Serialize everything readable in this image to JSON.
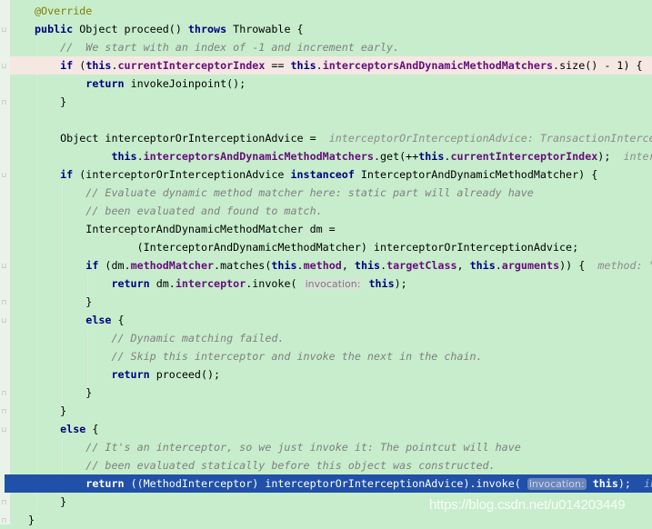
{
  "editor": {
    "background": "#c7edcc",
    "highlight_line": 4,
    "selected_line": 27,
    "watermark": "https://blog.csdn.net/u014203449"
  },
  "code": {
    "lines": [
      {
        "tokens": [
          [
            "a",
            "@Override"
          ]
        ]
      },
      {
        "tokens": [
          [
            "k",
            "public "
          ],
          [
            "p",
            "Object proceed() "
          ],
          [
            "k",
            "throws "
          ],
          [
            "p",
            "Throwable {"
          ]
        ]
      },
      {
        "tokens": [
          [
            "c",
            "    //  We start with an index of -1 and increment early."
          ]
        ]
      },
      {
        "tokens": [
          [
            "k",
            "    if "
          ],
          [
            "p",
            "("
          ],
          [
            "k",
            "this"
          ],
          [
            "p",
            "."
          ],
          [
            "f",
            "currentInterceptorIndex"
          ],
          [
            "p",
            " == "
          ],
          [
            "k",
            "this"
          ],
          [
            "p",
            "."
          ],
          [
            "f",
            "interceptorsAndDynamicMethodMatchers"
          ],
          [
            "p",
            ".size() - 1) {"
          ]
        ]
      },
      {
        "tokens": [
          [
            "k",
            "        return "
          ],
          [
            "p",
            "invokeJoinpoint();"
          ]
        ]
      },
      {
        "tokens": [
          [
            "p",
            "    }"
          ]
        ]
      },
      {
        "tokens": [
          [
            "p",
            ""
          ]
        ]
      },
      {
        "tokens": [
          [
            "p",
            "    Object interceptorOrInterceptionAdvice =  "
          ],
          [
            "h",
            "interceptorOrInterceptionAdvice: TransactionIntercep"
          ]
        ]
      },
      {
        "tokens": [
          [
            "k",
            "            this"
          ],
          [
            "p",
            "."
          ],
          [
            "f",
            "interceptorsAndDynamicMethodMatchers"
          ],
          [
            "p",
            ".get(++"
          ],
          [
            "k",
            "this"
          ],
          [
            "p",
            "."
          ],
          [
            "f",
            "currentInterceptorIndex"
          ],
          [
            "p",
            ");  "
          ],
          [
            "h",
            "inter"
          ]
        ]
      },
      {
        "tokens": [
          [
            "k",
            "    if "
          ],
          [
            "p",
            "(interceptorOrInterceptionAdvice "
          ],
          [
            "k",
            "instanceof "
          ],
          [
            "p",
            "InterceptorAndDynamicMethodMatcher) {"
          ]
        ]
      },
      {
        "tokens": [
          [
            "c",
            "        // Evaluate dynamic method matcher here: static part will already have"
          ]
        ]
      },
      {
        "tokens": [
          [
            "c",
            "        // been evaluated and found to match."
          ]
        ]
      },
      {
        "tokens": [
          [
            "p",
            "        InterceptorAndDynamicMethodMatcher dm ="
          ]
        ]
      },
      {
        "tokens": [
          [
            "p",
            "                (InterceptorAndDynamicMethodMatcher) interceptorOrInterceptionAdvice;"
          ]
        ]
      },
      {
        "tokens": [
          [
            "k",
            "        if "
          ],
          [
            "p",
            "(dm."
          ],
          [
            "f",
            "methodMatcher"
          ],
          [
            "p",
            ".matches("
          ],
          [
            "k",
            "this"
          ],
          [
            "p",
            "."
          ],
          [
            "f",
            "method"
          ],
          [
            "p",
            ", "
          ],
          [
            "k",
            "this"
          ],
          [
            "p",
            "."
          ],
          [
            "f",
            "targetClass"
          ],
          [
            "p",
            ", "
          ],
          [
            "k",
            "this"
          ],
          [
            "p",
            "."
          ],
          [
            "f",
            "arguments"
          ],
          [
            "p",
            ")) {  "
          ],
          [
            "h",
            "method: \""
          ]
        ]
      },
      {
        "tokens": [
          [
            "k",
            "            return "
          ],
          [
            "p",
            "dm."
          ],
          [
            "f",
            "interceptor"
          ],
          [
            "p",
            ".invoke( "
          ],
          [
            "hb",
            "invocation:"
          ],
          [
            "p",
            " "
          ],
          [
            "k",
            "this"
          ],
          [
            "p",
            ");"
          ]
        ]
      },
      {
        "tokens": [
          [
            "p",
            "        }"
          ]
        ]
      },
      {
        "tokens": [
          [
            "k",
            "        else "
          ],
          [
            "p",
            "{"
          ]
        ]
      },
      {
        "tokens": [
          [
            "c",
            "            // Dynamic matching failed."
          ]
        ]
      },
      {
        "tokens": [
          [
            "c",
            "            // Skip this interceptor and invoke the next in the chain."
          ]
        ]
      },
      {
        "tokens": [
          [
            "k",
            "            return "
          ],
          [
            "p",
            "proceed();"
          ]
        ]
      },
      {
        "tokens": [
          [
            "p",
            "        }"
          ]
        ]
      },
      {
        "tokens": [
          [
            "p",
            "    }"
          ]
        ]
      },
      {
        "tokens": [
          [
            "k",
            "    else "
          ],
          [
            "p",
            "{"
          ]
        ]
      },
      {
        "tokens": [
          [
            "c",
            "        // It's an interceptor, so we just invoke it: The pointcut will have"
          ]
        ]
      },
      {
        "tokens": [
          [
            "c",
            "        // been evaluated statically before this object was constructed."
          ]
        ]
      },
      {
        "tokens": [
          [
            "k",
            "        return "
          ],
          [
            "p",
            "((MethodInterceptor) interceptorOrInterceptionAdvice).invoke( "
          ],
          [
            "hb",
            "invocation:"
          ],
          [
            "p",
            " "
          ],
          [
            "k",
            "this"
          ],
          [
            "p",
            ");  "
          ],
          [
            "h",
            "in"
          ]
        ]
      },
      {
        "tokens": [
          [
            "p",
            "    }"
          ]
        ]
      },
      {
        "tokens": [
          [
            "p",
            "}"
          ]
        ]
      }
    ]
  }
}
